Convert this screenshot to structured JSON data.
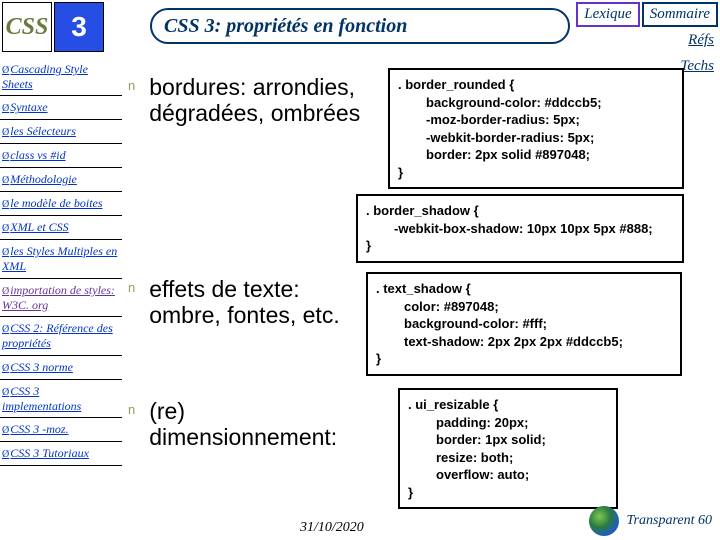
{
  "logos": {
    "css": "CSS",
    "css3": "3"
  },
  "top_buttons": {
    "lexique": "Lexique",
    "sommaire": "Sommaire"
  },
  "title": "CSS 3: propriétés en fonction",
  "links": {
    "refs": "Réfs",
    "techs": "Techs"
  },
  "sidebar": [
    {
      "label": "Cascading Style Sheets",
      "cls": "blue"
    },
    {
      "label": "Syntaxe",
      "cls": "blue"
    },
    {
      "label": "les Sélecteurs",
      "cls": "blue"
    },
    {
      "label": "class vs #id",
      "cls": "blue"
    },
    {
      "label": "Méthodologie",
      "cls": "blue"
    },
    {
      "label": "le modèle de boites",
      "cls": "blue"
    },
    {
      "label": "XML et CSS",
      "cls": "blue"
    },
    {
      "label": "les Styles Multiples en XML",
      "cls": "blue"
    },
    {
      "label": "importation de styles: W3C. org",
      "cls": "purple"
    },
    {
      "label": "CSS 2: Référence des propriétés",
      "cls": "blue"
    },
    {
      "label": "CSS 3 norme",
      "cls": "blue"
    },
    {
      "label": "CSS 3 implementations",
      "cls": "blue"
    },
    {
      "label": "CSS 3 -moz.",
      "cls": "blue"
    },
    {
      "label": "CSS 3 Tutoriaux",
      "cls": "blue"
    }
  ],
  "bullets": {
    "b1": "bordures: arrondies, dégradées, ombrées",
    "b2": "effets de texte: ombre, fontes, etc.",
    "b3": "(re) dimensionnement:",
    "n": "n"
  },
  "code": {
    "c1_l1": ". border_rounded {",
    "c1_l2": "background-color: #ddccb5;",
    "c1_l3": "-moz-border-radius: 5px;",
    "c1_l4": "-webkit-border-radius: 5px;",
    "c1_l5": "border: 2px solid #897048;",
    "c1_end": "}",
    "c2_l1": ". border_shadow {",
    "c2_l2": "-webkit-box-shadow: 10px 10px 5px #888;",
    "c2_end": "}",
    "c3_l1": ". text_shadow {",
    "c3_l2": "color: #897048;",
    "c3_l3": "background-color: #fff;",
    "c3_l4": "text-shadow: 2px 2px 2px #ddccb5;",
    "c3_end": "}",
    "c4_l1": ". ui_resizable {",
    "c4_l2": "padding: 20px;",
    "c4_l3": "border: 1px solid;",
    "c4_l4": "resize: both;",
    "c4_l5": "overflow: auto;",
    "c4_end": "}"
  },
  "footer": {
    "date": "31/10/2020",
    "slide": "Transparent 60"
  }
}
